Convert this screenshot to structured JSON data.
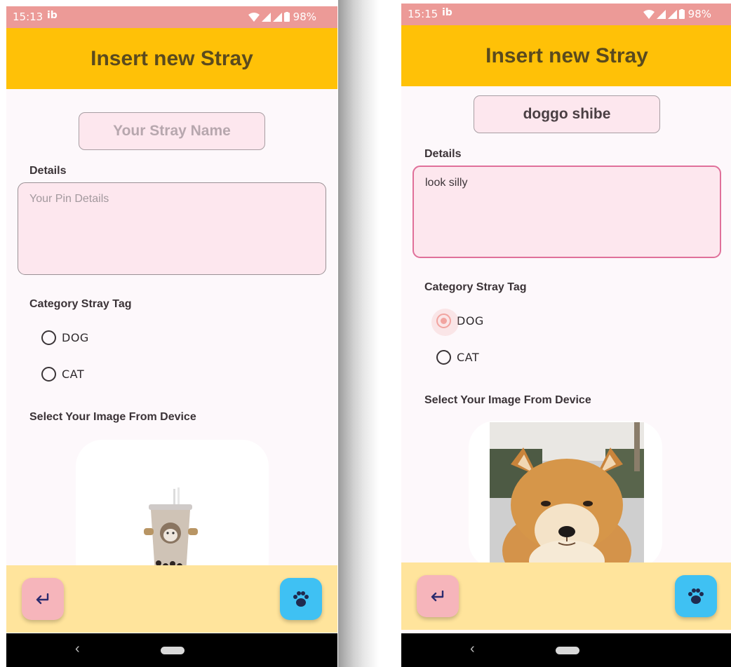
{
  "screens": {
    "left": {
      "status": {
        "time": "15:13",
        "notification_icon": "ib",
        "battery": "98%"
      },
      "app_bar": {
        "title": "Insert new Stray"
      },
      "name_input": {
        "value": "",
        "placeholder": "Your Stray Name"
      },
      "details": {
        "label": "Details",
        "value": "",
        "placeholder": "Your Pin Details"
      },
      "category": {
        "label": "Category Stray Tag",
        "options": [
          {
            "label": "DOG",
            "selected": false
          },
          {
            "label": "CAT",
            "selected": false
          }
        ]
      },
      "image_section": {
        "label": "Select Your Image From Device",
        "image": "boba-cat-image"
      },
      "fab_back_icon": "return-arrow-icon",
      "fab_paw_icon": "paw-icon"
    },
    "right": {
      "status": {
        "time": "15:15",
        "notification_icon": "ib",
        "battery": "98%"
      },
      "app_bar": {
        "title": "Insert new Stray"
      },
      "name_input": {
        "value": "doggo shibe",
        "placeholder": "Your Stray Name"
      },
      "details": {
        "label": "Details",
        "value": "look silly",
        "placeholder": "Your Pin Details"
      },
      "category": {
        "label": "Category Stray Tag",
        "options": [
          {
            "label": "DOG",
            "selected": true
          },
          {
            "label": "CAT",
            "selected": false
          }
        ]
      },
      "image_section": {
        "label": "Select Your Image From Device",
        "image": "shiba-dog-image"
      },
      "fab_back_icon": "return-arrow-icon",
      "fab_paw_icon": "paw-icon"
    }
  },
  "colors": {
    "status_bar": "#ec9a97",
    "app_bar": "#ffc107",
    "title_text": "#5a4a1e",
    "input_fill": "#fde7ee",
    "focused_border": "#e0709a",
    "radio_selected": "#f1a4a0",
    "bottom_bar": "#ffe49c",
    "fab_back": "#f6b5bb",
    "fab_paw": "#3fc1f3"
  }
}
